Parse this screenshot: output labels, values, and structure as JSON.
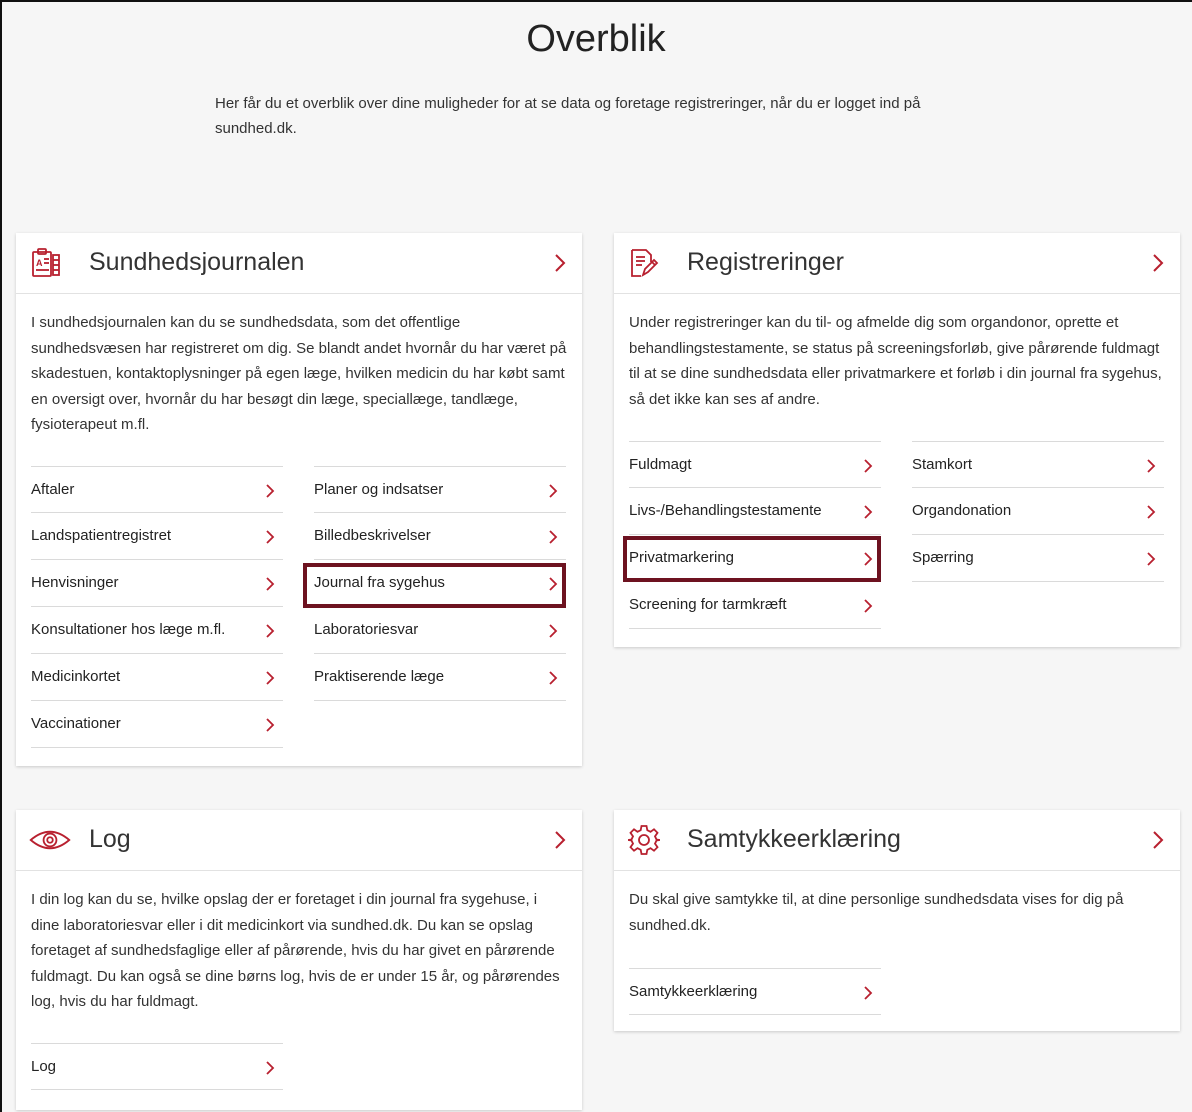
{
  "page": {
    "title": "Overblik",
    "intro": "Her får du et overblik over dine muligheder for at se data og foretage registreringer, når du er logget ind på sundhed.dk."
  },
  "colors": {
    "accent": "#b8202f",
    "highlight": "#6d1220"
  },
  "cards": {
    "sundhedsjournalen": {
      "title": "Sundhedsjournalen",
      "icon": "journal-icon",
      "description": "I sundhedsjournalen kan du se sundhedsdata, som det offentlige sundhedsvæsen har registreret om dig. Se blandt andet hvornår du har været på skadestuen, kontaktoplysninger på egen læge, hvilken medicin du har købt samt en oversigt over, hvornår du har besøgt din læge, speciallæge, tandlæge, fysioterapeut m.fl.",
      "left_links": [
        "Aftaler",
        "Landspatientregistret",
        "Henvisninger",
        "Konsultationer hos læge m.fl.",
        "Medicinkortet",
        "Vaccinationer"
      ],
      "right_links": [
        "Planer og indsatser",
        "Billedbeskrivelser",
        "Journal fra sygehus",
        "Laboratoriesvar",
        "Praktiserende læge"
      ]
    },
    "registreringer": {
      "title": "Registreringer",
      "icon": "edit-document-icon",
      "description": "Under registreringer kan du til- og afmelde dig som organdonor, oprette et behandlingstestamente, se status på screeningsforløb, give pårørende fuldmagt til at se dine sundhedsdata eller privatmarkere et forløb i din journal fra sygehus, så det ikke kan ses af andre.",
      "left_links": [
        "Fuldmagt",
        "Livs-/Behandlingstestamente",
        "Privatmarkering",
        "Screening for tarmkræft"
      ],
      "right_links": [
        "Stamkort",
        "Organdonation",
        "Spærring"
      ]
    },
    "log": {
      "title": "Log",
      "icon": "eye-icon",
      "description": "I din log kan du se, hvilke opslag der er foretaget i din journal fra sygehuse, i dine laboratoriesvar eller i dit medicinkort via sundhed.dk. Du kan se opslag foretaget af sundhedsfaglige eller af pårørende, hvis du har givet en pårørende fuldmagt. Du kan også se dine børns log, hvis de er under 15 år, og pårørendes log, hvis du har fuldmagt.",
      "left_links": [
        "Log"
      ]
    },
    "samtykke": {
      "title": "Samtykkeerklæring",
      "icon": "gear-icon",
      "description": "Du skal give samtykke til, at dine personlige sundhedsdata vises for dig på sundhed.dk.",
      "left_links": [
        "Samtykkeerklæring"
      ]
    }
  }
}
